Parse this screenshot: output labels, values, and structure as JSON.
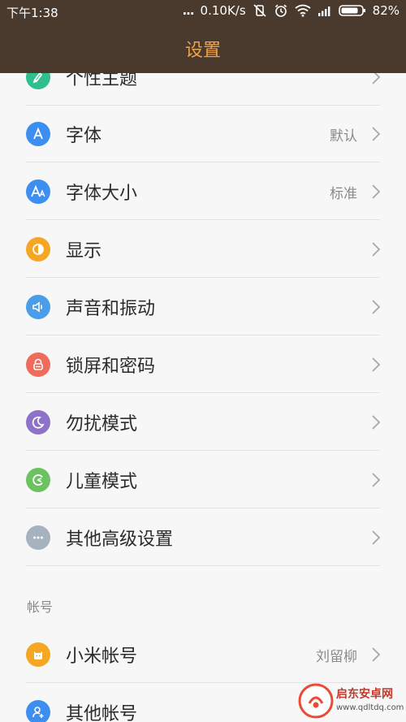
{
  "status": {
    "time": "下午1:38",
    "dots": "...",
    "speed": "0.10K/s",
    "battery": "82%"
  },
  "header": {
    "title": "设置"
  },
  "settings": {
    "items": [
      {
        "label": "个性主题",
        "value": "",
        "icon": "theme-icon",
        "color": "#2ebf8c"
      },
      {
        "label": "字体",
        "value": "默认",
        "icon": "font-icon",
        "color": "#3c8ef0"
      },
      {
        "label": "字体大小",
        "value": "标准",
        "icon": "font-size-icon",
        "color": "#3c8ef0"
      },
      {
        "label": "显示",
        "value": "",
        "icon": "display-icon",
        "color": "#f5a623"
      },
      {
        "label": "声音和振动",
        "value": "",
        "icon": "speaker-icon",
        "color": "#4a9de8"
      },
      {
        "label": "锁屏和密码",
        "value": "",
        "icon": "lock-icon",
        "color": "#ef6b5b"
      },
      {
        "label": "勿扰模式",
        "value": "",
        "icon": "moon-icon",
        "color": "#8e72c8"
      },
      {
        "label": "儿童模式",
        "value": "",
        "icon": "child-mode-icon",
        "color": "#6cc261"
      },
      {
        "label": "其他高级设置",
        "value": "",
        "icon": "more-icon",
        "color": "#a7b2bf"
      }
    ]
  },
  "account": {
    "section_title": "帐号",
    "items": [
      {
        "label": "小米帐号",
        "value": "刘留柳",
        "icon": "mi-account-icon",
        "color": "#f5a623"
      },
      {
        "label": "其他帐号",
        "value": "",
        "icon": "add-account-icon",
        "color": "#3c8ef0"
      }
    ]
  },
  "watermark": {
    "name": "启东安卓网",
    "url": "www.qdltdq.com"
  }
}
